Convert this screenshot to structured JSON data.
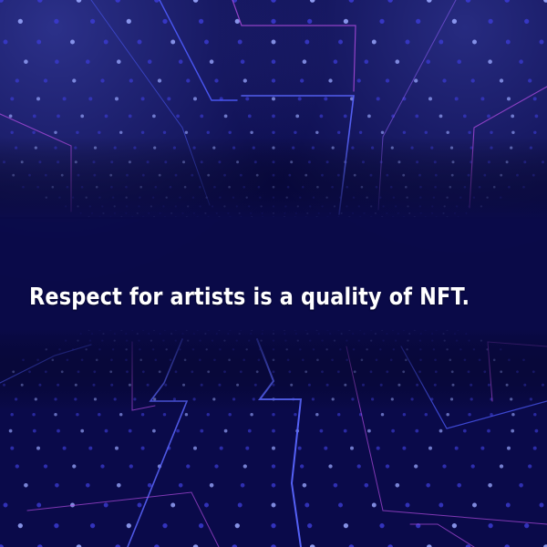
{
  "headline": "Respect for artists is a quality of NFT.",
  "colors": {
    "background": "#0a0a4a",
    "dot_light": "#9aa8ff",
    "dot_dark": "#3a3ad0",
    "line_pink": "#b04ce0",
    "line_blue": "#4f5cff",
    "text": "#ffffff"
  }
}
